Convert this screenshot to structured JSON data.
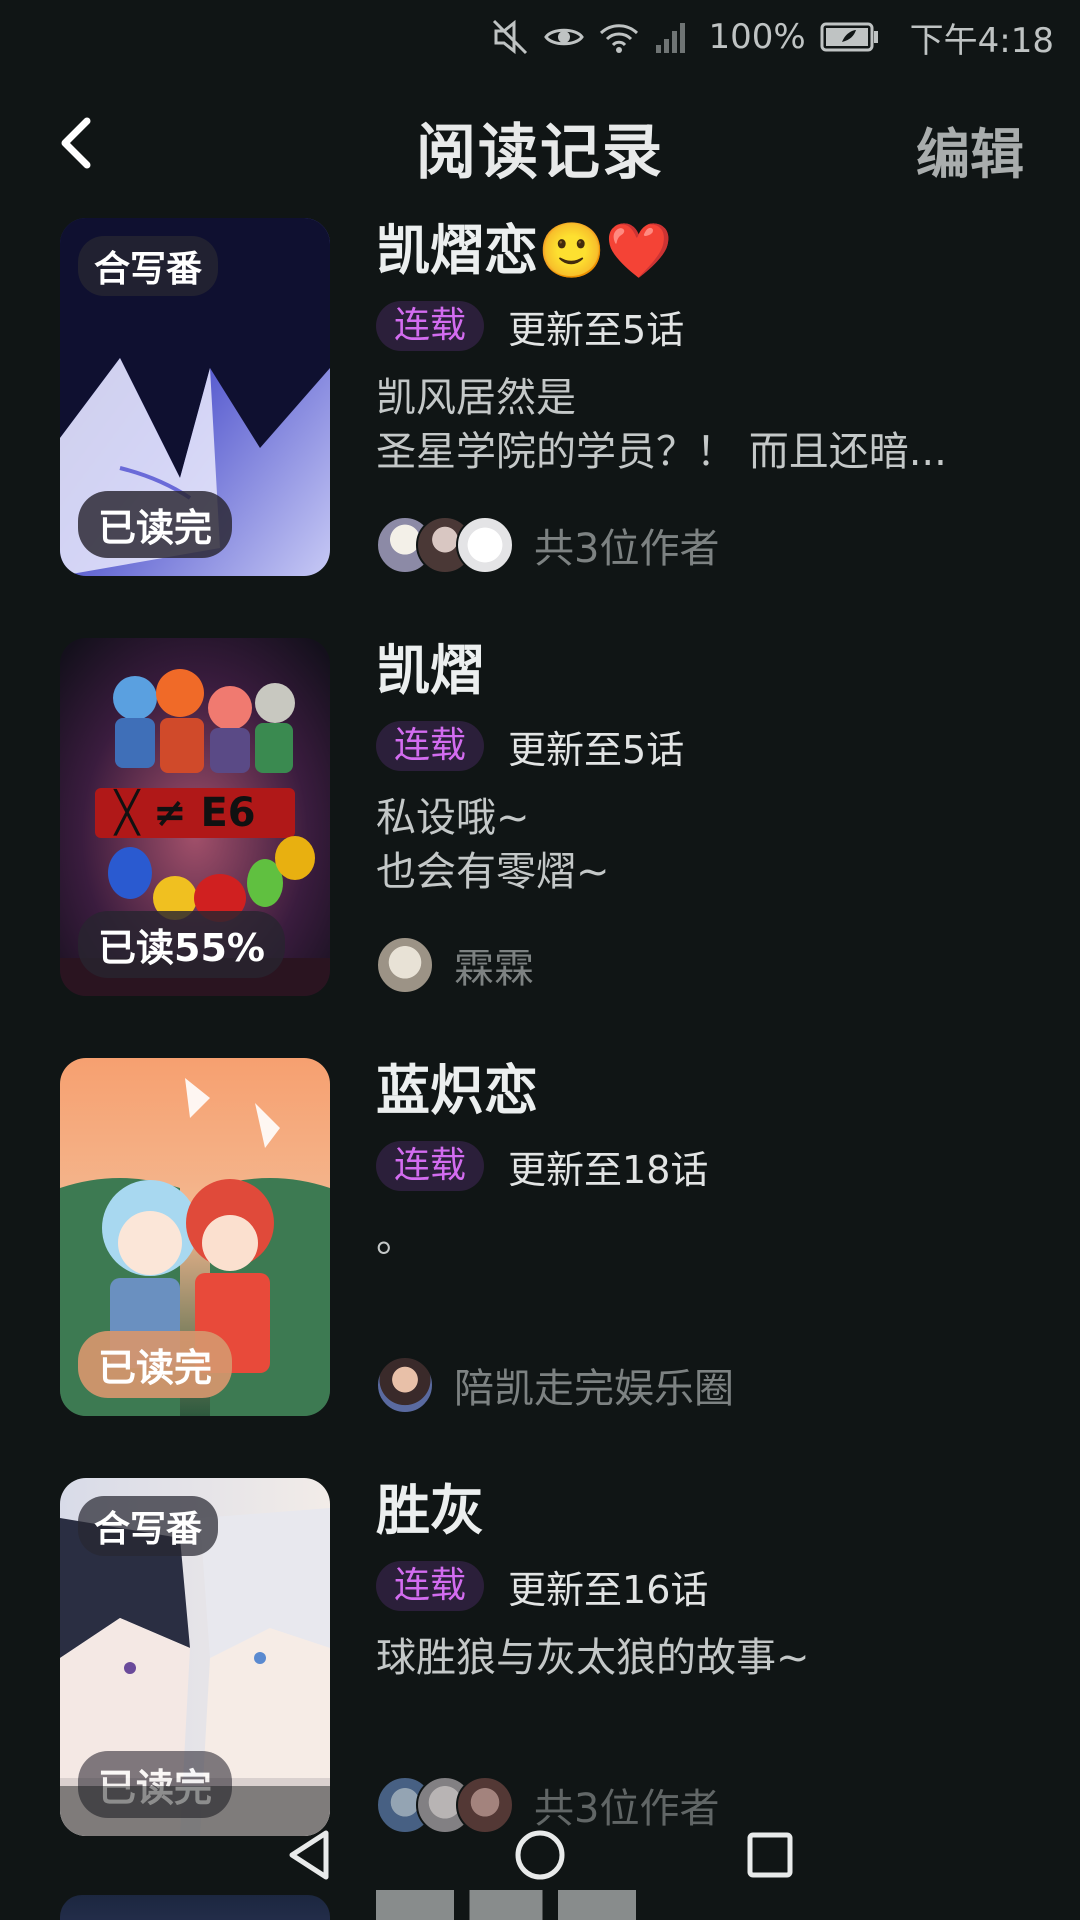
{
  "status_bar": {
    "battery_percent": "100%",
    "time": "下午4:18",
    "icons": [
      "mute-icon",
      "eye-icon",
      "wifi-icon",
      "signal-icon",
      "battery-icon"
    ]
  },
  "header": {
    "title": "阅读记录",
    "edit_label": "编辑",
    "back_icon": "chevron-left-icon"
  },
  "items": [
    {
      "title": "凯熠恋🙂❤️",
      "tag_top": "合写番",
      "progress_label": "已读完",
      "status": "连载",
      "update": "更新至5话",
      "desc_line1": "凯风居然是",
      "desc_line2": "圣星学院的学员？！ 而且还暗...",
      "author_label": "共3位作者",
      "avatar_count": 3
    },
    {
      "title": "凯熠",
      "tag_top": "",
      "progress_label": "已读55%",
      "progress_value": 0.55,
      "status": "连载",
      "update": "更新至5话",
      "desc_line1": "私设哦~",
      "desc_line2": "也会有零熠~",
      "author_label": "霖霖",
      "avatar_count": 1
    },
    {
      "title": "蓝炽恋",
      "tag_top": "",
      "progress_label": "已读完",
      "status": "连载",
      "update": "更新至18话",
      "desc_line1": "。",
      "desc_line2": "",
      "author_label": "陪凯走完娱乐圈",
      "avatar_count": 1
    },
    {
      "title": "胜灰",
      "tag_top": "合写番",
      "progress_label": "已读完",
      "status": "连载",
      "update": "更新至16话",
      "desc_line1": "球胜狼与灰太狼的故事~",
      "desc_line2": "",
      "author_label": "共3位作者",
      "avatar_count": 3
    }
  ],
  "nav": {
    "back_icon": "triangle-back-icon",
    "home_icon": "circle-home-icon",
    "recents_icon": "square-recents-icon"
  },
  "colors": {
    "background": "#101515",
    "accent_purple": "#d36cf0",
    "pill_bg": "#2b1f3a"
  }
}
